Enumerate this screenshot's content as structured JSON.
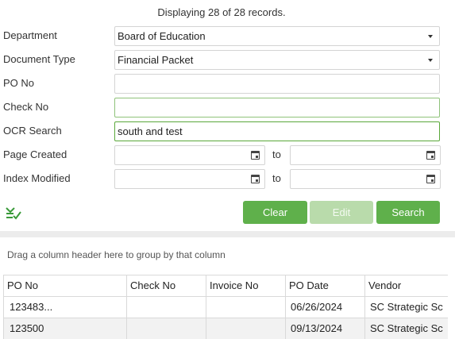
{
  "records_info": "Displaying 28 of 28 records.",
  "filters": {
    "department": {
      "label": "Department",
      "value": "Board of Education"
    },
    "document_type": {
      "label": "Document Type",
      "value": "Financial Packet"
    },
    "po_no": {
      "label": "PO No",
      "value": ""
    },
    "check_no": {
      "label": "Check No",
      "value": ""
    },
    "ocr_search": {
      "label": "OCR Search",
      "value": "south and test"
    },
    "page_created": {
      "label": "Page Created",
      "to_label": "to",
      "from_value": "",
      "to_value": ""
    },
    "index_modified": {
      "label": "Index Modified",
      "to_label": "to",
      "from_value": "",
      "to_value": ""
    }
  },
  "buttons": {
    "clear": "Clear",
    "edit": "Edit",
    "search": "Search"
  },
  "grid": {
    "group_hint": "Drag a column header here to group by that column",
    "columns": [
      "PO No",
      "Check No",
      "Invoice No",
      "PO Date",
      "Vendor"
    ],
    "rows": [
      [
        "123483...",
        "",
        "",
        "06/26/2024",
        "SC Strategic Sc"
      ],
      [
        "123500",
        "",
        "",
        "09/13/2024",
        "SC Strategic Sc"
      ]
    ]
  },
  "colors": {
    "accent": "#5fb04b",
    "accent_disabled": "#b9dbab"
  },
  "icons": {
    "toolbar": "checklist-icon",
    "calendar": "calendar-icon"
  }
}
